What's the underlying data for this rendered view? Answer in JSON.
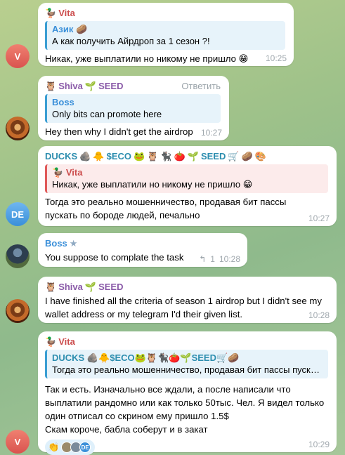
{
  "messages": [
    {
      "avatar": "V",
      "author": "Vita",
      "author_icon": "duck-icon",
      "quote_author": "Азик",
      "quote_author_emoji": "🥔",
      "quote_text": "А как получить Айрдроп за 1 сезон ?!",
      "text": "Никак, уже выплатили но никому не пришло 😁",
      "time": "10:25"
    },
    {
      "author": "Shiva",
      "author_icon": "owl-icon",
      "author_suffix": "SEED",
      "action": "Ответить",
      "quote_author": "Boss",
      "quote_text": "Only bits can promote here",
      "text": "Hey then why I didn't get the airdrop",
      "time": "10:27"
    },
    {
      "avatar": "DE",
      "author": "DUCKS",
      "author_eco": "$ECO",
      "author_seed": "SEED",
      "quote_author": "Vita",
      "quote_text": "Никак, уже выплатили но никому не пришло 😁",
      "text": "Тогда это реально мошенничество, продавая бит пассы пускать по бороде людей, печально",
      "time": "10:27"
    },
    {
      "author": "Boss",
      "author_icon": "star-icon",
      "text": "You suppose to complate the task",
      "views": "1",
      "time": "10:28"
    },
    {
      "author": "Shiva",
      "author_suffix": "SEED",
      "text": "I have finished all the criteria of season 1 airdrop but I didn't see my wallet address or my telegram I'd their given list.",
      "time": "10:28"
    },
    {
      "avatar": "V",
      "author": "Vita",
      "quote_author": "DUCKS",
      "quote_eco": "$ECO",
      "quote_seed": "SEED",
      "quote_text": "Тогда это реально мошенничество, продавая бит пассы пускать по бороде людей, печально",
      "text_lines": [
        "Так и есть. Изначально все ждали, а после написали что",
        "выплатили рандомно или как только 50тыс. Чел. Я видел только",
        "один отписал со скрином ему пришло 1.5$",
        "Скам короче, бабла соберут и в закат"
      ],
      "reaction_emoji": "👏",
      "reaction_avatar": "DE",
      "time": "10:29"
    }
  ],
  "colors": {
    "background": "#a5c58f",
    "bubble": "#ffffff",
    "vita_name": "#cc4d4d",
    "shiva_name": "#8a5aa8",
    "ducks_name": "#2d8eaf",
    "boss_name": "#3a8fd9",
    "quote_blue": "#3a9ed3",
    "quote_red": "#e05a5a"
  }
}
